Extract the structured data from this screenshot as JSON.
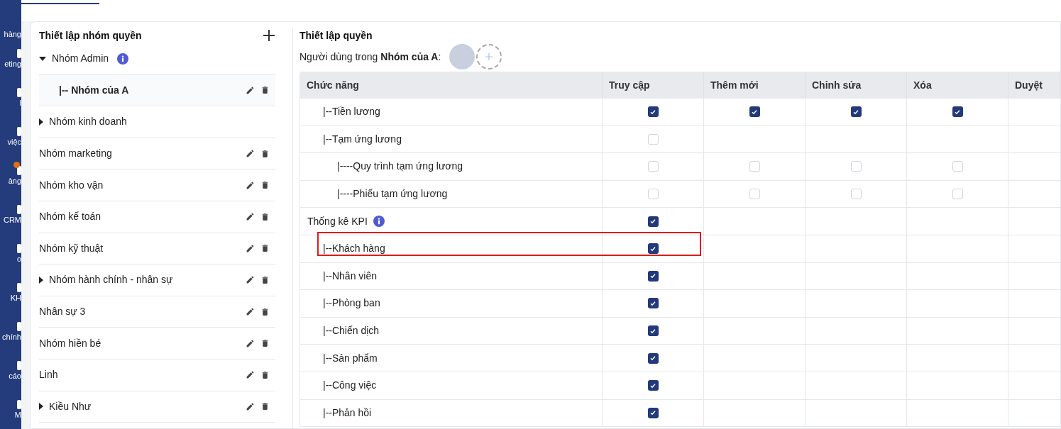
{
  "sidebar": {
    "items": [
      {
        "label": "hàng",
        "dot": false
      },
      {
        "label": "eting",
        "dot": false
      },
      {
        "label": "I",
        "dot": false
      },
      {
        "label": "việc",
        "dot": false
      },
      {
        "label": "àng",
        "dot": true
      },
      {
        "label": "CRM",
        "dot": false
      },
      {
        "label": "o",
        "dot": false
      },
      {
        "label": "KH",
        "dot": false
      },
      {
        "label": "chính",
        "dot": false
      },
      {
        "label": "cáo",
        "dot": false
      },
      {
        "label": "M",
        "dot": false
      }
    ]
  },
  "groups_panel": {
    "title": "Thiết lập nhóm quyền",
    "groups": [
      {
        "label": "Nhóm Admin",
        "expandable": true,
        "expanded": true,
        "info": true,
        "actions": false,
        "selected": false,
        "children": [
          {
            "label": "|-- Nhóm của A",
            "expandable": false,
            "expanded": false,
            "info": false,
            "actions": true,
            "selected": true
          }
        ]
      },
      {
        "label": "Nhóm kinh doanh",
        "expandable": true,
        "expanded": false,
        "info": false,
        "actions": false,
        "selected": false
      },
      {
        "label": "Nhóm marketing",
        "expandable": false,
        "expanded": false,
        "info": false,
        "actions": true,
        "selected": false
      },
      {
        "label": "Nhóm kho vận",
        "expandable": false,
        "expanded": false,
        "info": false,
        "actions": true,
        "selected": false
      },
      {
        "label": "Nhóm kế toán",
        "expandable": false,
        "expanded": false,
        "info": false,
        "actions": true,
        "selected": false
      },
      {
        "label": "Nhóm kỹ thuật",
        "expandable": false,
        "expanded": false,
        "info": false,
        "actions": true,
        "selected": false
      },
      {
        "label": "Nhóm hành chính - nhân sự",
        "expandable": true,
        "expanded": false,
        "info": false,
        "actions": true,
        "selected": false
      },
      {
        "label": "Nhân sự 3",
        "expandable": false,
        "expanded": false,
        "info": false,
        "actions": true,
        "selected": false
      },
      {
        "label": "Nhóm hiền bé",
        "expandable": false,
        "expanded": false,
        "info": false,
        "actions": true,
        "selected": false
      },
      {
        "label": "Linh",
        "expandable": false,
        "expanded": false,
        "info": false,
        "actions": true,
        "selected": false
      },
      {
        "label": "Kiều Như",
        "expandable": true,
        "expanded": false,
        "info": false,
        "actions": true,
        "selected": false
      }
    ]
  },
  "permissions": {
    "title": "Thiết lập quyền",
    "users_label": "Người dùng trong **Nhóm của A**:",
    "table": {
      "columns": [
        "Chức năng",
        "Truy cập",
        "Thêm mới",
        "Chỉnh sửa",
        "Xóa",
        "Duyệt"
      ],
      "rows": [
        {
          "children": [
            {
              "label": "|--Tiền lương",
              "info": false,
              "highlighted": false,
              "cells": [
                {
                  "kind": "checkbox",
                  "checked": true
                },
                {
                  "kind": "checkbox",
                  "checked": true
                },
                {
                  "kind": "checkbox",
                  "checked": true
                },
                {
                  "kind": "checkbox",
                  "checked": true
                },
                {
                  "kind": "blank"
                }
              ]
            },
            {
              "label": "|--Tạm ứng lương",
              "info": false,
              "highlighted": false,
              "cells": [
                {
                  "kind": "checkbox",
                  "checked": false
                },
                {
                  "kind": "blank"
                },
                {
                  "kind": "blank"
                },
                {
                  "kind": "blank"
                },
                {
                  "kind": "blank"
                }
              ],
              "children": [
                {
                  "label": "|----Quy trình tạm ứng lương",
                  "info": false,
                  "highlighted": false,
                  "cells": [
                    {
                      "kind": "checkbox",
                      "checked": false
                    },
                    {
                      "kind": "checkbox",
                      "checked": false
                    },
                    {
                      "kind": "checkbox",
                      "checked": false
                    },
                    {
                      "kind": "checkbox",
                      "checked": false
                    },
                    {
                      "kind": "blank"
                    }
                  ]
                },
                {
                  "label": "|----Phiếu tạm ứng lương",
                  "info": false,
                  "highlighted": false,
                  "cells": [
                    {
                      "kind": "checkbox",
                      "checked": false
                    },
                    {
                      "kind": "checkbox",
                      "checked": false
                    },
                    {
                      "kind": "checkbox",
                      "checked": false
                    },
                    {
                      "kind": "checkbox",
                      "checked": false
                    },
                    {
                      "kind": "blank"
                    }
                  ]
                }
              ]
            }
          ]
        },
        {
          "label": "Thống kê KPI",
          "info": true,
          "highlighted": false,
          "cells": [
            {
              "kind": "checkbox",
              "checked": true
            },
            {
              "kind": "blank"
            },
            {
              "kind": "blank"
            },
            {
              "kind": "blank"
            },
            {
              "kind": "blank"
            }
          ],
          "children": [
            {
              "label": "|--Khách hàng",
              "info": false,
              "highlighted": true,
              "cells": [
                {
                  "kind": "checkbox",
                  "checked": true
                },
                {
                  "kind": "blank"
                },
                {
                  "kind": "blank"
                },
                {
                  "kind": "blank"
                },
                {
                  "kind": "blank"
                }
              ]
            },
            {
              "label": "|--Nhân viên",
              "info": false,
              "highlighted": false,
              "cells": [
                {
                  "kind": "checkbox",
                  "checked": true
                },
                {
                  "kind": "blank"
                },
                {
                  "kind": "blank"
                },
                {
                  "kind": "blank"
                },
                {
                  "kind": "blank"
                }
              ]
            },
            {
              "label": "|--Phòng ban",
              "info": false,
              "highlighted": false,
              "cells": [
                {
                  "kind": "checkbox",
                  "checked": true
                },
                {
                  "kind": "blank"
                },
                {
                  "kind": "blank"
                },
                {
                  "kind": "blank"
                },
                {
                  "kind": "blank"
                }
              ]
            },
            {
              "label": "|--Chiến dịch",
              "info": false,
              "highlighted": false,
              "cells": [
                {
                  "kind": "checkbox",
                  "checked": true
                },
                {
                  "kind": "blank"
                },
                {
                  "kind": "blank"
                },
                {
                  "kind": "blank"
                },
                {
                  "kind": "blank"
                }
              ]
            },
            {
              "label": "|--Sản phẩm",
              "info": false,
              "highlighted": false,
              "cells": [
                {
                  "kind": "checkbox",
                  "checked": true
                },
                {
                  "kind": "blank"
                },
                {
                  "kind": "blank"
                },
                {
                  "kind": "blank"
                },
                {
                  "kind": "blank"
                }
              ]
            },
            {
              "label": "|--Công việc",
              "info": false,
              "highlighted": false,
              "cells": [
                {
                  "kind": "checkbox",
                  "checked": true
                },
                {
                  "kind": "blank"
                },
                {
                  "kind": "blank"
                },
                {
                  "kind": "blank"
                },
                {
                  "kind": "blank"
                }
              ]
            },
            {
              "label": "|--Phản hồi",
              "info": false,
              "highlighted": false,
              "cells": [
                {
                  "kind": "checkbox",
                  "checked": true
                },
                {
                  "kind": "blank"
                },
                {
                  "kind": "blank"
                },
                {
                  "kind": "blank"
                },
                {
                  "kind": "blank"
                }
              ]
            }
          ]
        }
      ]
    }
  }
}
